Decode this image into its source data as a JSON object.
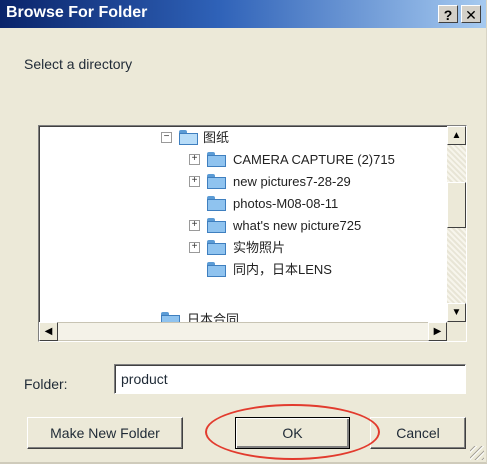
{
  "window": {
    "title": "Browse For Folder",
    "help_label": "?",
    "close_label": "✕"
  },
  "prompt": "Select a directory",
  "tree": {
    "rows": [
      {
        "label": "图纸",
        "expander": "−",
        "open": true
      },
      {
        "label": "CAMERA CAPTURE (2)715",
        "expander": "+"
      },
      {
        "label": "new pictures7-28-29",
        "expander": "+"
      },
      {
        "label": "photos-M08-08-11",
        "expander": ""
      },
      {
        "label": "what's new picture725",
        "expander": "+"
      },
      {
        "label": "实物照片",
        "expander": "+"
      },
      {
        "label": "同内，日本LENS",
        "expander": ""
      },
      {
        "label": "日本合同",
        "expander": ""
      }
    ],
    "scroll_up": "▲",
    "scroll_down": "▼",
    "scroll_left": "◀",
    "scroll_right": "▶"
  },
  "folder": {
    "label": "Folder:",
    "value": "product"
  },
  "buttons": {
    "make_new_folder": "Make New Folder",
    "ok": "OK",
    "cancel": "Cancel"
  },
  "colors": {
    "title_gradient_start": "#0a246a",
    "title_gradient_end": "#a6caf0",
    "dialog_bg": "#ece9d8",
    "highlight_ring": "#e23b2e"
  }
}
